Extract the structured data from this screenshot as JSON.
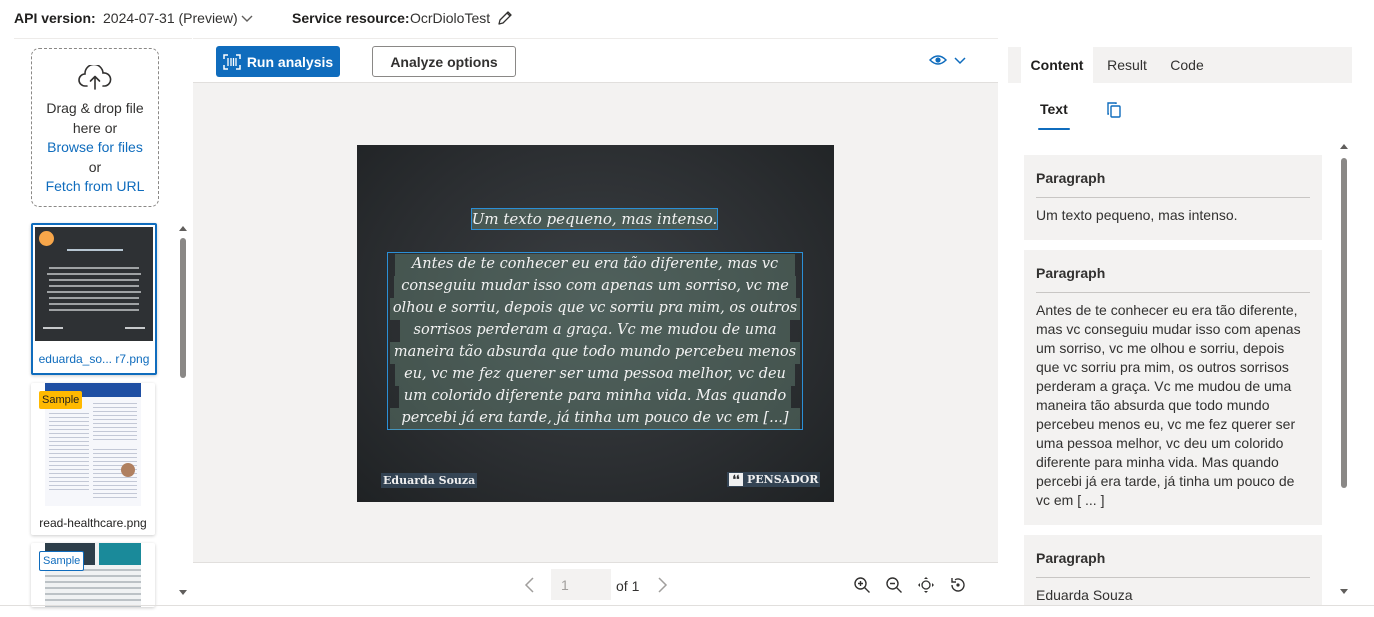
{
  "topbar": {
    "api_label": "API version:",
    "api_value": "2024-07-31 (Preview)",
    "service_label": "Service resource:",
    "service_value": "OcrDioloTest"
  },
  "dropzone": {
    "line1": "Drag & drop file",
    "line2": "here or",
    "browse": "Browse for files",
    "or": "or",
    "fetch": "Fetch from URL"
  },
  "files": [
    {
      "name": "eduarda_so... r7.png",
      "selected": true
    },
    {
      "name": "read-healthcare.png",
      "badge": "Sample"
    },
    {
      "name": "",
      "badge": "Sample"
    }
  ],
  "toolbar": {
    "run_label": "Run analysis",
    "options_label": "Analyze options"
  },
  "document": {
    "title_line": "Um texto pequeno, mas intenso.",
    "body_lines": [
      "Antes de te conhecer eu era tão diferente, mas vc",
      "conseguiu mudar isso com apenas um sorriso, vc me",
      "olhou e sorriu, depois que vc sorriu pra mim, os outros",
      "sorrisos perderam a graça. Vc me mudou de uma",
      "maneira tão absurda que todo mundo percebeu menos",
      "eu, vc me fez querer ser uma pessoa melhor, vc deu",
      "um colorido diferente para minha vida. Mas quando",
      "percebi já era tarde, já tinha um pouco de vc em [...]"
    ],
    "author": "Eduarda Souza",
    "brand": "PENSADOR",
    "brand_icon": "❛❛"
  },
  "pager": {
    "page_value": "1",
    "of_label": "of 1"
  },
  "results": {
    "tabs": [
      "Content",
      "Result",
      "Code"
    ],
    "active_tab": "Content",
    "subtab": "Text",
    "paragraphs": [
      {
        "title": "Paragraph",
        "text": "Um texto pequeno, mas intenso."
      },
      {
        "title": "Paragraph",
        "text": "Antes de te conhecer eu era tão diferente, mas vc conseguiu mudar isso com apenas um sorriso, vc me olhou e sorriu, depois que vc sorriu pra mim, os outros sorrisos perderam a graça. Vc me mudou de uma maneira tão absurda que todo mundo percebeu menos eu, vc me fez querer ser uma pessoa melhor, vc deu um colorido diferente para minha vida. Mas quando percebi já era tarde, já tinha um pouco de vc em [ ... ]"
      },
      {
        "title": "Paragraph",
        "text": "Eduarda Souza"
      }
    ]
  },
  "colors": {
    "accent": "#0f6cbd",
    "ocr_box": "#2b8fd6",
    "sample_badge": "#ffb900"
  },
  "icons": [
    "chevron-down-icon",
    "edit-icon",
    "upload-cloud-icon",
    "scan-icon",
    "eye-icon",
    "chevron-left-icon",
    "chevron-right-icon",
    "zoom-in-icon",
    "zoom-out-icon",
    "fit-icon",
    "rotate-icon",
    "copy-icon"
  ]
}
